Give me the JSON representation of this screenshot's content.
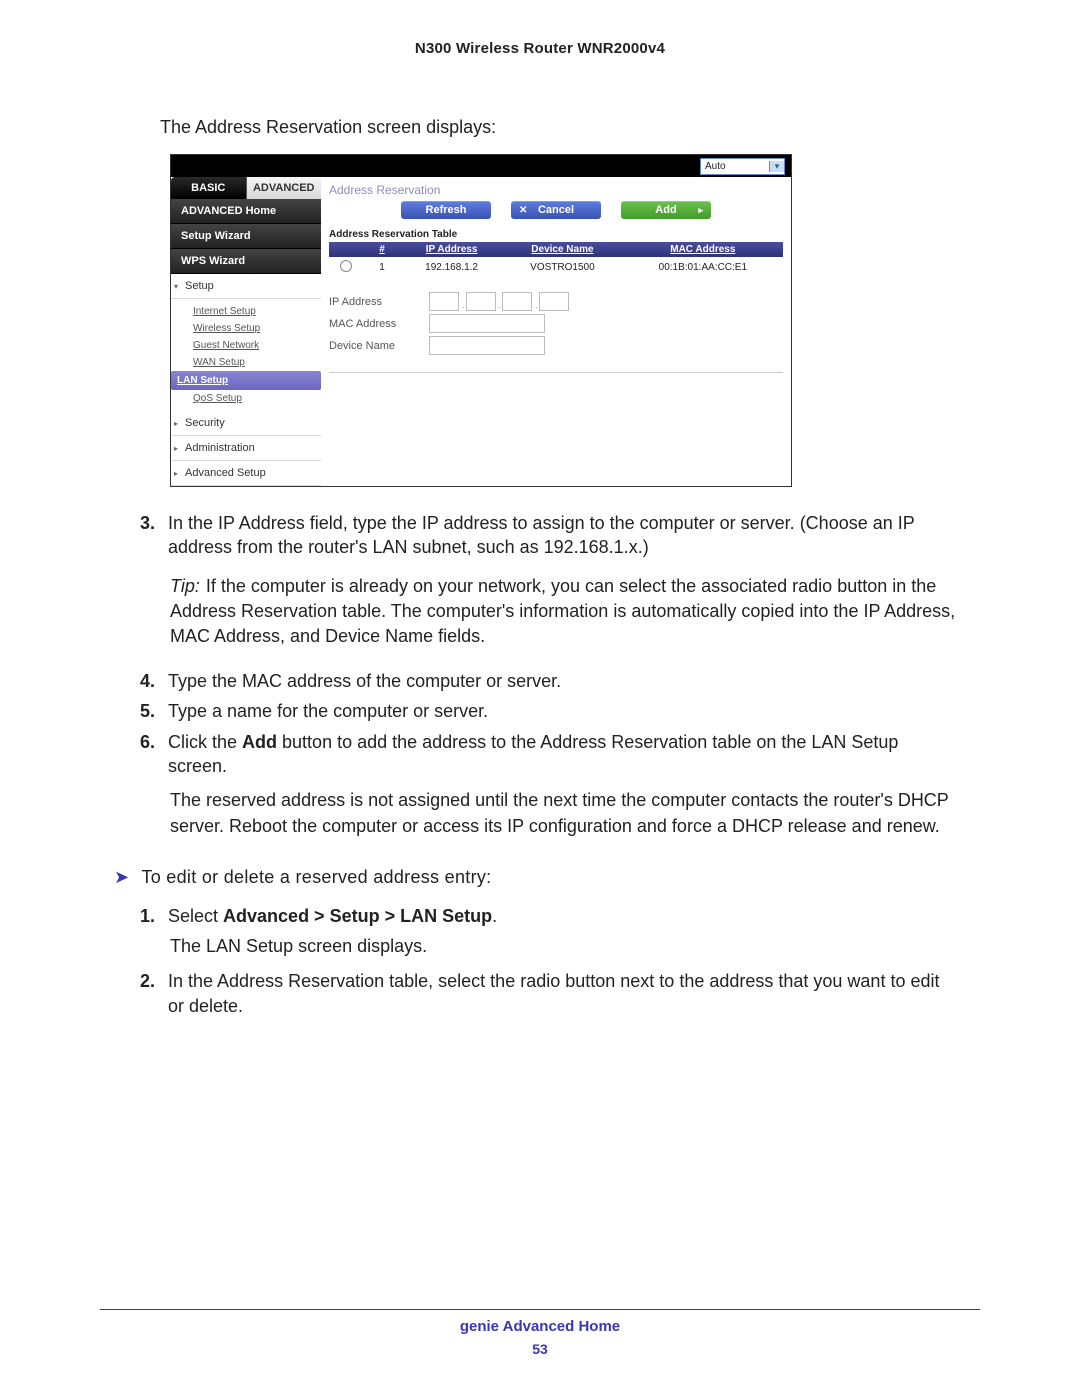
{
  "document": {
    "header": "N300 Wireless Router WNR2000v4",
    "intro": "The Address Reservation screen displays:",
    "footer_title": "genie Advanced Home",
    "page_number": "53"
  },
  "router": {
    "auto_label": "Auto",
    "tabs": {
      "basic": "BASIC",
      "advanced": "ADVANCED"
    },
    "side": {
      "home": "ADVANCED Home",
      "setup_wizard": "Setup Wizard",
      "wps_wizard": "WPS Wizard",
      "setup": "Setup",
      "setup_items": {
        "internet": "Internet Setup",
        "wireless": "Wireless Setup",
        "guest": "Guest Network",
        "wan": "WAN Setup",
        "lan": "LAN Setup",
        "qos": "QoS Setup"
      },
      "security": "Security",
      "administration": "Administration",
      "advanced_setup": "Advanced Setup"
    },
    "main": {
      "title": "Address Reservation",
      "buttons": {
        "refresh": "Refresh",
        "cancel": "Cancel",
        "add": "Add"
      },
      "table_caption": "Address Reservation Table",
      "columns": {
        "hash": "#",
        "ip": "IP Address",
        "device": "Device Name",
        "mac": "MAC Address"
      },
      "row": {
        "index": "1",
        "ip": "192.168.1.2",
        "device": "VOSTRO1500",
        "mac": "00:1B:01:AA:CC:E1"
      },
      "form": {
        "ip_label": "IP Address",
        "mac_label": "MAC Address",
        "name_label": "Device Name"
      }
    }
  },
  "steps": {
    "s3_num": "3.",
    "s3": "In the IP Address field, type the IP address to assign to the computer or server. (Choose an IP address from the router's LAN subnet, such as 192.168.1.x.)",
    "tip_label": "Tip:",
    "tip": "If the computer is already on your network, you can select the associated radio button in the Address Reservation table. The computer's information is automatically copied into the IP Address, MAC Address, and Device Name fields.",
    "s4_num": "4.",
    "s4": "Type the MAC address of the computer or server.",
    "s5_num": "5.",
    "s5": "Type a name for the computer or server.",
    "s6_num": "6.",
    "s6a": "Click the ",
    "s6b": "Add",
    "s6c": " button to add the address to the Address Reservation table on the LAN Setup screen.",
    "s6_para": "The reserved address is not assigned until the next time the computer contacts the router's DHCP server. Reboot the computer or access its IP configuration and force a DHCP release and renew."
  },
  "proc2": {
    "heading": "To edit or delete a reserved address entry:",
    "s1_num": "1.",
    "s1a": "Select ",
    "s1b": "Advanced > Setup > LAN Setup",
    "s1c": ".",
    "s1_para": "The LAN Setup screen displays.",
    "s2_num": "2.",
    "s2": "In the Address Reservation table, select the radio button next to the address that you want to edit or delete."
  }
}
